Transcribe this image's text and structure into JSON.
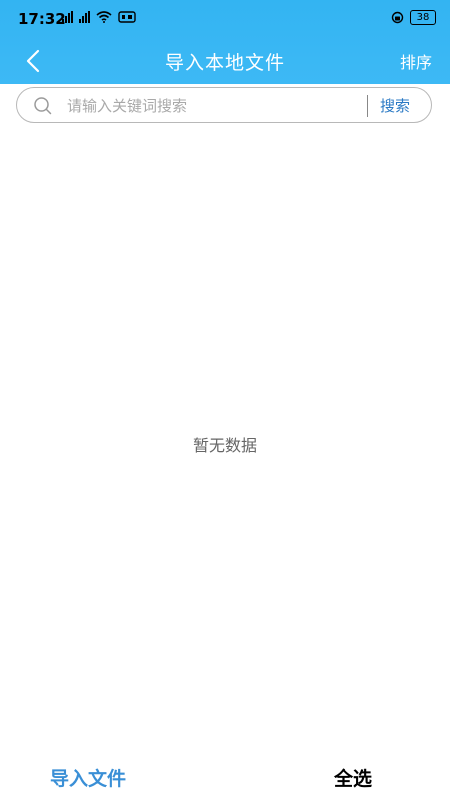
{
  "status_bar": {
    "time": "17:32",
    "battery": "38"
  },
  "header": {
    "title": "导入本地文件",
    "sort_label": "排序"
  },
  "search": {
    "placeholder": "请输入关键词搜索",
    "value": "",
    "button_label": "搜索"
  },
  "content": {
    "empty_text": "暂无数据"
  },
  "bottom_bar": {
    "import_label": "导入文件",
    "select_all_label": "全选"
  },
  "colors": {
    "header_bg": "#3db9f5",
    "accent": "#3a8fd6",
    "search_button": "#2a79c4"
  },
  "icons": [
    "back-arrow-icon",
    "search-icon",
    "signal-icon",
    "wifi-icon",
    "alarm-icon",
    "battery-icon"
  ]
}
